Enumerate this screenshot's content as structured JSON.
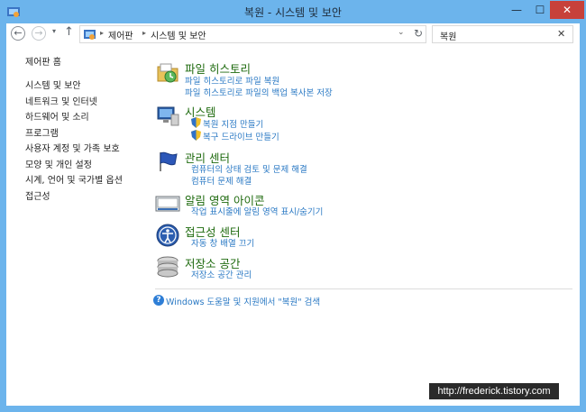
{
  "window": {
    "title": "복원 - 시스템 및 보안",
    "minimize_glyph": "—",
    "maximize_glyph": "☐",
    "close_glyph": "✕"
  },
  "address_bar": {
    "back_glyph": "←",
    "forward_glyph": "→",
    "recent_glyph": "▾",
    "up_glyph": "↑",
    "breadcrumbs": [
      "제어판",
      "시스템 및 보안"
    ],
    "crumb_separator": "▸",
    "dropdown_glyph": "⌄",
    "refresh_glyph": "↻"
  },
  "search": {
    "value": "복원",
    "clear_glyph": "✕"
  },
  "sidebar": {
    "home": "제어판 홈",
    "items": [
      {
        "label": "시스템 및 보안"
      },
      {
        "label": "네트워크 및 인터넷"
      },
      {
        "label": "하드웨어 및 소리"
      },
      {
        "label": "프로그램"
      },
      {
        "label": "사용자 계정 및 가족 보호"
      },
      {
        "label": "모양 및 개인 설정"
      },
      {
        "label": "시계, 언어 및 국가별 옵션"
      },
      {
        "label": "접근성"
      }
    ]
  },
  "categories": [
    {
      "title": "파일 히스토리",
      "icon": "file-history-icon",
      "links": [
        {
          "label": "파일 히스토리로 파일 복원",
          "shield": false
        },
        {
          "label": "파일 히스토리로 파일의 백업 복사본 저장",
          "shield": false
        }
      ]
    },
    {
      "title": "시스템",
      "icon": "system-icon",
      "links": [
        {
          "label": "복원 지점 만들기",
          "shield": true
        },
        {
          "label": "복구 드라이브 만들기",
          "shield": true
        }
      ]
    },
    {
      "title": "관리 센터",
      "icon": "action-center-flag-icon",
      "links": [
        {
          "label": "컴퓨터의 상태 검토 및 문제 해결",
          "shield": false
        },
        {
          "label": "컴퓨터 문제 해결",
          "shield": false
        }
      ]
    },
    {
      "title": "알림 영역 아이콘",
      "icon": "notification-area-icon",
      "links": [
        {
          "label": "작업 표시줄에 알림 영역 표시/숨기기",
          "shield": false
        }
      ]
    },
    {
      "title": "접근성 센터",
      "icon": "ease-of-access-icon",
      "links": [
        {
          "label": "자동 창 배열 끄기",
          "shield": false
        }
      ]
    },
    {
      "title": "저장소 공간",
      "icon": "storage-spaces-icon",
      "links": [
        {
          "label": "저장소 공간 관리",
          "shield": false
        }
      ]
    }
  ],
  "help": {
    "glyph": "?",
    "label": "Windows 도움말 및 지원에서 \"복원\" 검색"
  },
  "watermark": "http://frederick.tistory.com",
  "colors": {
    "titlebar": "#6cb4ec",
    "category_title": "#1e6a0e",
    "link": "#2a79c4",
    "close_button": "#c7413a"
  }
}
